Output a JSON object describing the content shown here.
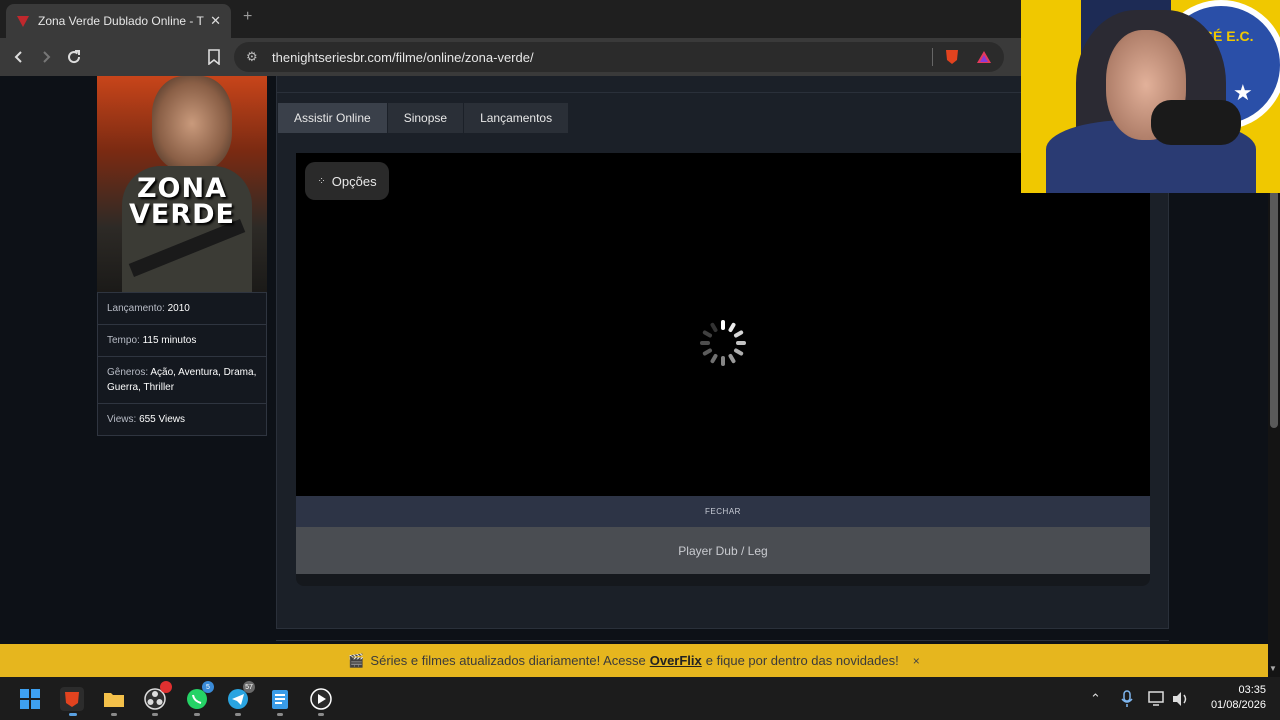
{
  "browser": {
    "tab_title": "Zona Verde Dublado Online - Th",
    "new_tab": "+",
    "url": "thenightseriesbr.com/filme/online/zona-verde/",
    "brave_badge": "49"
  },
  "movie": {
    "poster_title_line1": "ZONA",
    "poster_title_line2": "VERDE",
    "info": [
      {
        "key": "Lançamento:",
        "value": "2010"
      },
      {
        "key": "Tempo:",
        "value": "115 minutos"
      },
      {
        "key": "Gêneros:",
        "value": "Ação, Aventura, Drama, Guerra, Thriller"
      },
      {
        "key": "Views:",
        "value": "655 Views"
      }
    ]
  },
  "page_tabs": [
    {
      "label": "Assistir Online"
    },
    {
      "label": "Sinopse"
    },
    {
      "label": "Lançamentos"
    }
  ],
  "player": {
    "options_label": "Opções",
    "close_label": "FECHAR",
    "player_select_label": "Player Dub / Leg"
  },
  "notice": {
    "prefix": "Séries e filmes atualizados diariamente! Acesse",
    "link": "OverFlix",
    "suffix": "e fique por dentro das novidades!",
    "close": "×"
  },
  "taskbar": {
    "time": "03:35",
    "date": "01/08/2026",
    "whatsapp_badge": "5",
    "telegram_badge": "57"
  },
  "webcam": {
    "crest_text": "D JOSÉ E.C."
  },
  "colors": {
    "notice_bg": "#e6b61e",
    "page_bg": "#0d1117",
    "accent_tab": "#3a404a"
  }
}
